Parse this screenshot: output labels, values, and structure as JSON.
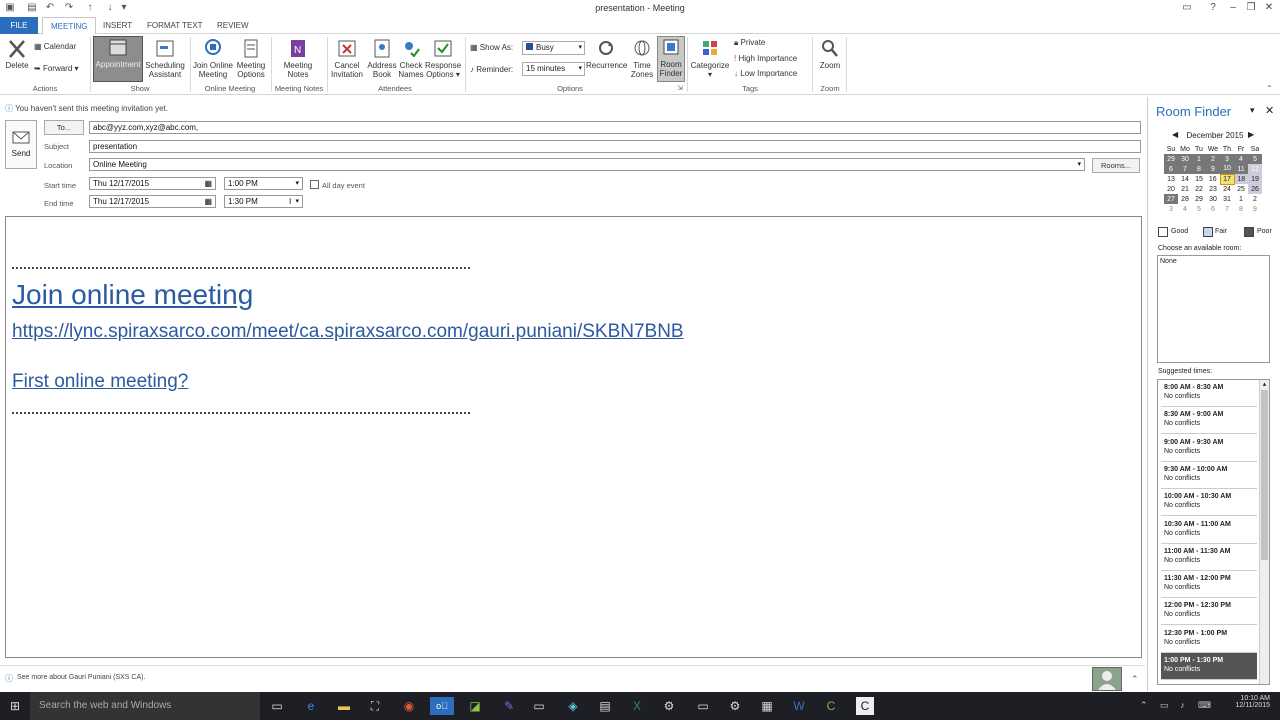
{
  "window": {
    "title": "presentation - Meeting"
  },
  "tabs": [
    "FILE",
    "MEETING",
    "INSERT",
    "FORMAT TEXT",
    "REVIEW"
  ],
  "ribbon": {
    "actions": {
      "delete": "Delete",
      "calendar": "Calendar",
      "forward": "Forward",
      "group": "Actions"
    },
    "show": {
      "appointment": "Appointment",
      "scheduling": "Scheduling",
      "assistant": "Assistant",
      "group": "Show"
    },
    "online": {
      "join1": "Join Online",
      "join2": "Meeting",
      "mo1": "Meeting",
      "mo2": "Options",
      "group": "Online Meeting"
    },
    "notes": {
      "n1": "Meeting",
      "n2": "Notes",
      "group": "Meeting Notes"
    },
    "attendees": {
      "c1": "Cancel",
      "c2": "Invitation",
      "a1": "Address",
      "a2": "Book",
      "k1": "Check",
      "k2": "Names",
      "r1": "Response",
      "r2": "Options",
      "group": "Attendees"
    },
    "options": {
      "show_as": "Show As:",
      "show_as_val": "Busy",
      "reminder": "Reminder:",
      "reminder_val": "15 minutes",
      "recurrence": "Recurrence",
      "tz1": "Time",
      "tz2": "Zones",
      "rf1": "Room",
      "rf2": "Finder",
      "group": "Options"
    },
    "tags": {
      "categorize": "Categorize",
      "private": "Private",
      "high": "High Importance",
      "low": "Low Importance",
      "group": "Tags"
    },
    "zoom": {
      "zoom": "Zoom",
      "group": "Zoom"
    }
  },
  "info": "You haven't sent this meeting invitation yet.",
  "form": {
    "send": "Send",
    "to_btn": "To...",
    "to_val": "abc@yyz.com,xyz@abc.com,",
    "subject_lbl": "Subject",
    "subject_val": "presentation",
    "location_lbl": "Location",
    "location_val": "Online Meeting",
    "rooms_btn": "Rooms...",
    "start_lbl": "Start time",
    "start_date": "Thu 12/17/2015",
    "start_time": "1:00 PM",
    "all_day": "All day event",
    "end_lbl": "End time",
    "end_date": "Thu 12/17/2015",
    "end_time": "1:30 PM"
  },
  "body": {
    "join": "Join online meeting",
    "url": "https://lync.spiraxsarco.com/meet/ca.spiraxsarco.com/gauri.puniani/SKBN7BNB",
    "first": "First online meeting?"
  },
  "room_finder": {
    "title": "Room Finder",
    "month": "December 2015",
    "days": [
      "Su",
      "Mo",
      "Tu",
      "We",
      "Th",
      "Fr",
      "Sa"
    ],
    "weeks": [
      [
        "29",
        "30",
        "1",
        "2",
        "3",
        "4",
        "5"
      ],
      [
        "6",
        "7",
        "8",
        "9",
        "10",
        "11",
        "12"
      ],
      [
        "13",
        "14",
        "15",
        "16",
        "17",
        "18",
        "19"
      ],
      [
        "20",
        "21",
        "22",
        "23",
        "24",
        "25",
        "26"
      ],
      [
        "27",
        "28",
        "29",
        "30",
        "31",
        "1",
        "2"
      ],
      [
        "3",
        "4",
        "5",
        "6",
        "7",
        "8",
        "9"
      ]
    ],
    "good": "Good",
    "fair": "Fair",
    "poor": "Poor",
    "choose": "Choose an available room:",
    "room_none": "None",
    "suggested": "Suggested times:",
    "slots": [
      {
        "time": "8:00 AM - 8:30 AM",
        "status": "No conflicts"
      },
      {
        "time": "8:30 AM - 9:00 AM",
        "status": "No conflicts"
      },
      {
        "time": "9:00 AM - 9:30 AM",
        "status": "No conflicts"
      },
      {
        "time": "9:30 AM - 10:00 AM",
        "status": "No conflicts"
      },
      {
        "time": "10:00 AM - 10:30 AM",
        "status": "No conflicts"
      },
      {
        "time": "10:30 AM - 11:00 AM",
        "status": "No conflicts"
      },
      {
        "time": "11:00 AM - 11:30 AM",
        "status": "No conflicts"
      },
      {
        "time": "11:30 AM - 12:00 PM",
        "status": "No conflicts"
      },
      {
        "time": "12:00 PM - 12:30 PM",
        "status": "No conflicts"
      },
      {
        "time": "12:30 PM - 1:00 PM",
        "status": "No conflicts"
      },
      {
        "time": "1:00 PM - 1:30 PM",
        "status": "No conflicts"
      }
    ]
  },
  "status": {
    "text": "See more about Gauri Puniani (SXS CA)."
  },
  "taskbar": {
    "search": "Search the web and Windows",
    "time": "10:10 AM",
    "date": "12/11/2015"
  },
  "colors": {
    "accent": "#2a6ebd",
    "link": "#2c5aa0"
  }
}
